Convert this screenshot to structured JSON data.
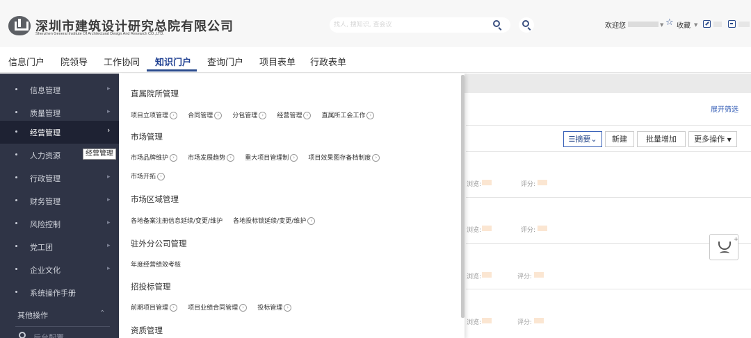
{
  "header": {
    "logo_cn": "深圳市建筑设计研究总院有限公司",
    "logo_en": "Shenzhen General Institute Of Architectural Design And Research CO.,LTD.",
    "search_placeholder": "找人, 搜知识, 查会议",
    "welcome": "欢迎您",
    "favorites": "收藏"
  },
  "nav": {
    "tabs": [
      "信息门户",
      "院领导",
      "工作协同",
      "知识门户",
      "查询门户",
      "项目表单",
      "行政表单"
    ],
    "active_index": 3
  },
  "sidebar": {
    "items": [
      {
        "label": "信息管理",
        "arrow": "▸"
      },
      {
        "label": "质量管理",
        "arrow": "▸"
      },
      {
        "label": "经营管理",
        "arrow": "›"
      },
      {
        "label": "人力资源",
        "arrow": ""
      },
      {
        "label": "行政管理",
        "arrow": "▸"
      },
      {
        "label": "财务管理",
        "arrow": "▸"
      },
      {
        "label": "风险控制",
        "arrow": "▸"
      },
      {
        "label": "党工团",
        "arrow": "▸"
      },
      {
        "label": "企业文化",
        "arrow": "▸"
      },
      {
        "label": "系统操作手册",
        "arrow": ""
      }
    ],
    "active_index": 2,
    "tooltip": "经营管理",
    "other_ops": "其他操作",
    "other_caret": "⌃",
    "bottom_item": "后台配置"
  },
  "dropdown": {
    "sections": [
      {
        "title": "直属院所管理",
        "links": [
          "项目立项管理",
          "合同管理",
          "分包管理",
          "经营管理",
          "直属所工会工作"
        ]
      },
      {
        "title": "市场管理",
        "links": [
          "市场品牌维护",
          "市场发展趋势",
          "重大项目管理制",
          "项目效果图存备档制度"
        ],
        "links2": [
          "市场开拓"
        ]
      },
      {
        "title": "市场区域管理",
        "links": [
          "各地备案注册信息延续/变更/维护",
          "各地投标锁延续/变更/维护"
        ]
      },
      {
        "title": "驻外分公司管理",
        "links": [
          "年度经营绩效考核"
        ],
        "no_circle": true
      },
      {
        "title": "招投标管理",
        "links": [
          "前期项目管理",
          "项目业绩合同管理",
          "投标管理"
        ]
      },
      {
        "title": "资质管理",
        "links": []
      }
    ],
    "circle_glyph": "›"
  },
  "content": {
    "expand_filter": "展开筛选",
    "buttons": {
      "summary": "摘要",
      "new": "新建",
      "batch_add": "批量增加",
      "more_ops": "更多操作"
    },
    "row_meta": {
      "views": "浏览:",
      "score": "评分:"
    }
  },
  "colors": {
    "brand": "#2a4b8d",
    "sidebar_bg": "#2f3446",
    "sidebar_active": "#1e2233",
    "link_blue": "#3a62b8"
  }
}
